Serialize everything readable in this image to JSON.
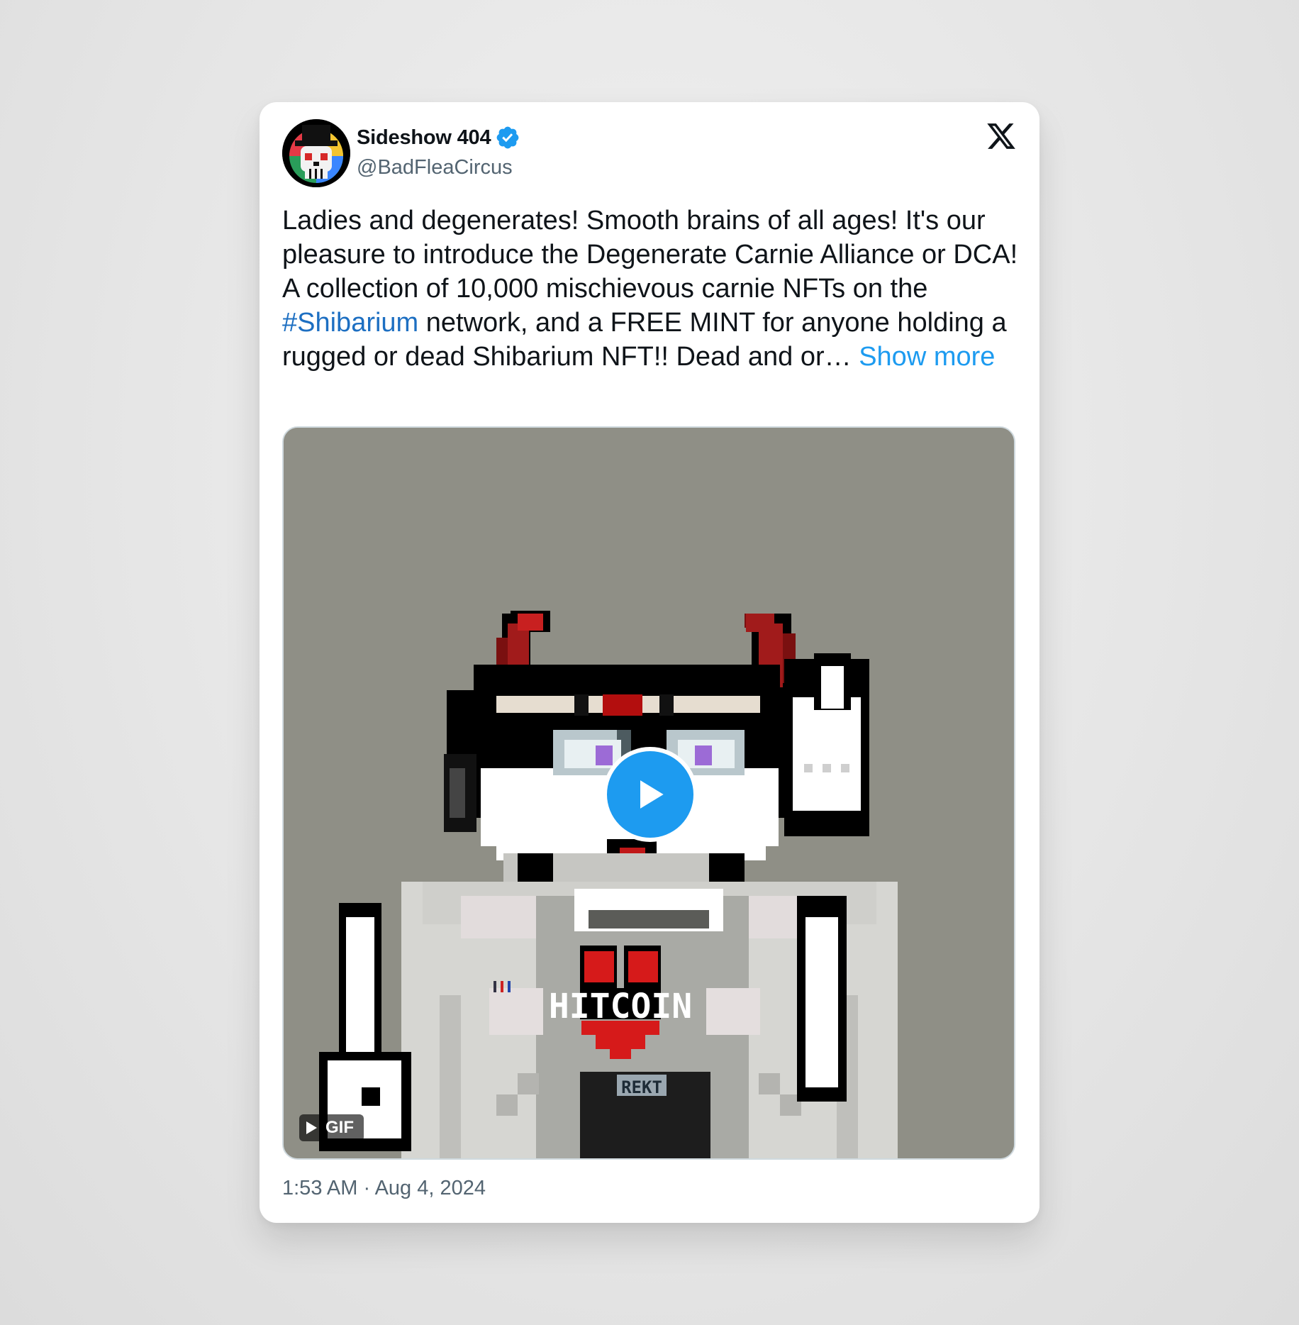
{
  "author": {
    "display_name": "Sideshow 404",
    "handle": "@BadFleaCircus",
    "verified": true,
    "avatar_icon": "skull-top-hat-avatar"
  },
  "platform_logo": "x-logo-icon",
  "tweet": {
    "text_1": "Ladies and degenerates! Smooth brains of all ages! It's our pleasure to introduce the Degenerate Carnie Alliance or DCA! A collection of 10,000 mischievous carnie NFTs on the ",
    "hashtag": "#Shibarium",
    "text_2": " network, and a FREE MINT for anyone holding a rugged or dead Shibarium NFT!! Dead and or… ",
    "show_more": "Show more"
  },
  "media": {
    "type": "gif",
    "badge_label": "GIF",
    "shirt_text": "HITCOIN",
    "belt_text": "REKT"
  },
  "timestamp": "1:53 AM · Aug 4, 2024",
  "colors": {
    "link": "#1d9bf0",
    "hashtag": "#1d6fc2",
    "text": "#0f1419",
    "muted": "#536471",
    "media_bg": "#8f8f86"
  }
}
